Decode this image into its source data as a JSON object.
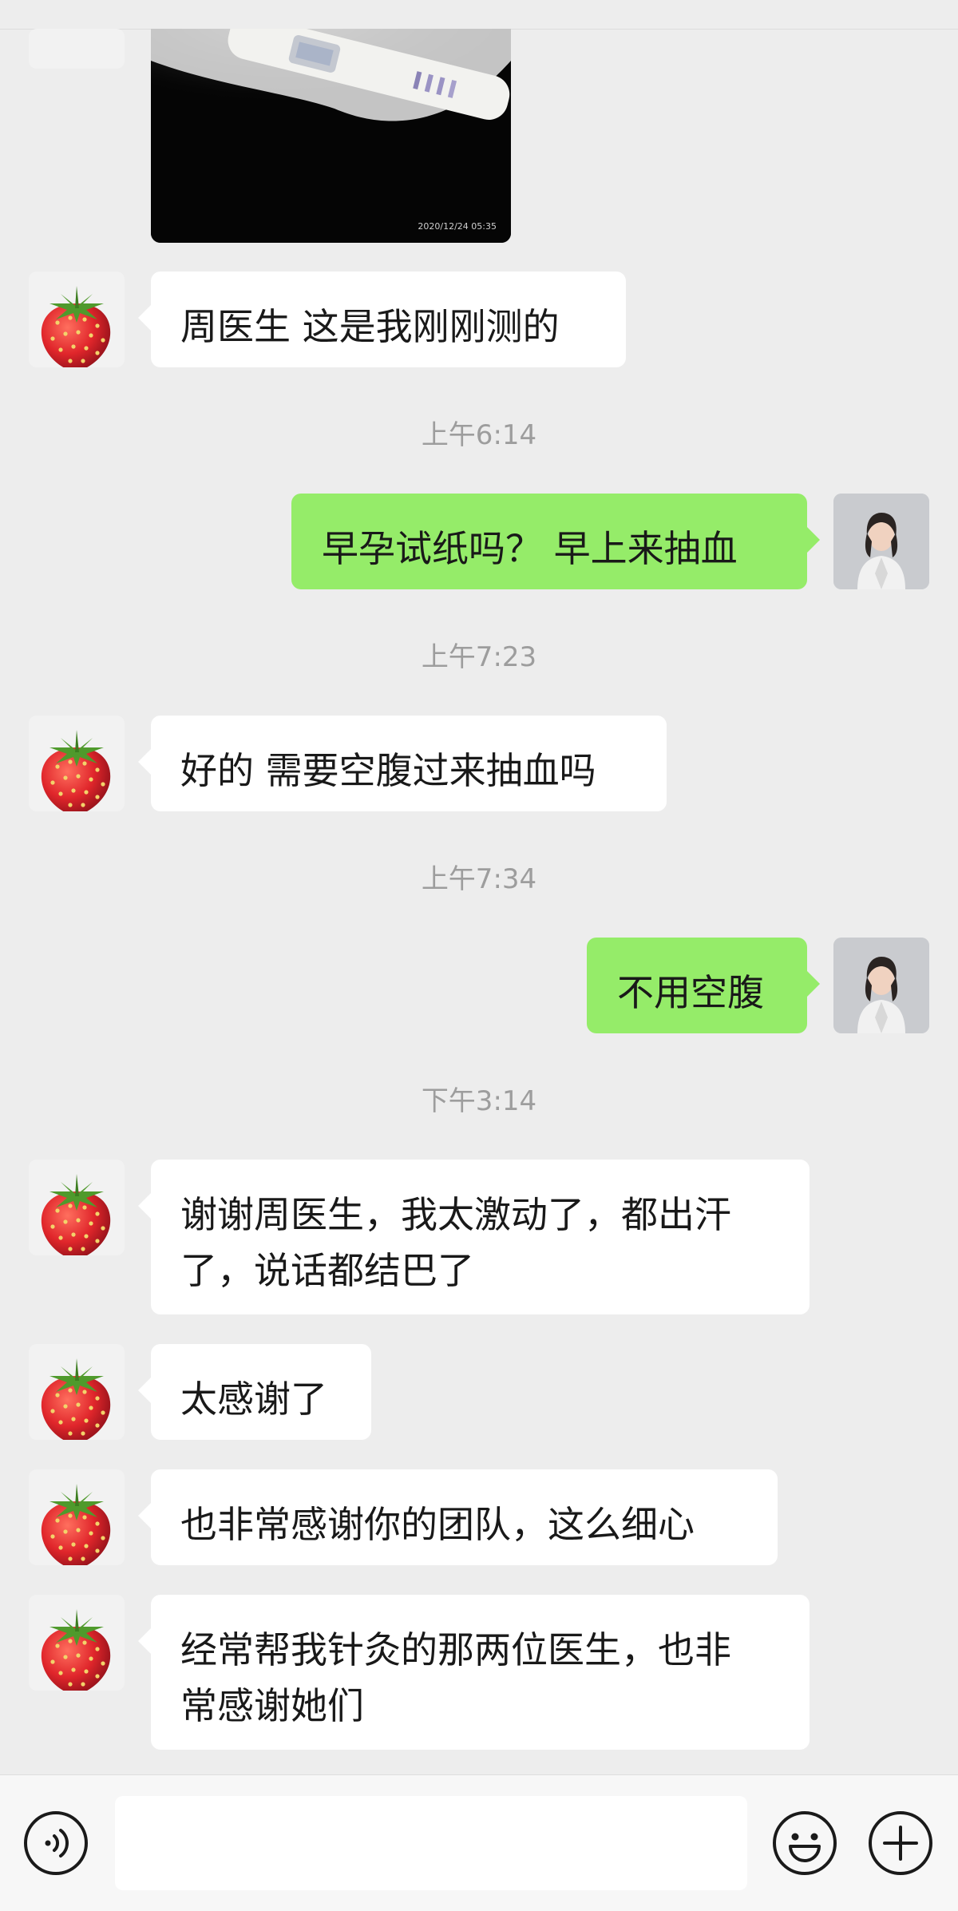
{
  "photo": {
    "timestamp": "2020/12/24 05:35"
  },
  "timestamps": [
    "上午6:14",
    "上午7:23",
    "上午7:34",
    "下午3:14"
  ],
  "messages": [
    {
      "side": "received",
      "text": "周医生 这是我刚刚测的"
    },
    {
      "side": "sent",
      "text": "早孕试纸吗？ 早上来抽血"
    },
    {
      "side": "received",
      "text": "好的 需要空腹过来抽血吗"
    },
    {
      "side": "sent",
      "text": "不用空腹"
    },
    {
      "side": "received",
      "lines": [
        "谢谢周医生，我太激动了，都出汗",
        "了，说话都结巴了"
      ]
    },
    {
      "side": "received",
      "text": "太感谢了"
    },
    {
      "side": "received",
      "text": "也非常感谢你的团队，这么细心"
    },
    {
      "side": "received",
      "lines": [
        "经常帮我针灸的那两位医生，也非",
        "常感谢她们"
      ]
    }
  ],
  "avatars": {
    "contact": "strawberry-avatar",
    "self": "doctor-avatar"
  },
  "input_bar": {
    "voice_icon": "voice-icon",
    "emoji_icon": "emoji-icon",
    "more_icon": "plus-icon",
    "text": ""
  },
  "colors": {
    "background": "#ededed",
    "sent_bubble": "#95ec69",
    "received_bubble": "#ffffff"
  }
}
